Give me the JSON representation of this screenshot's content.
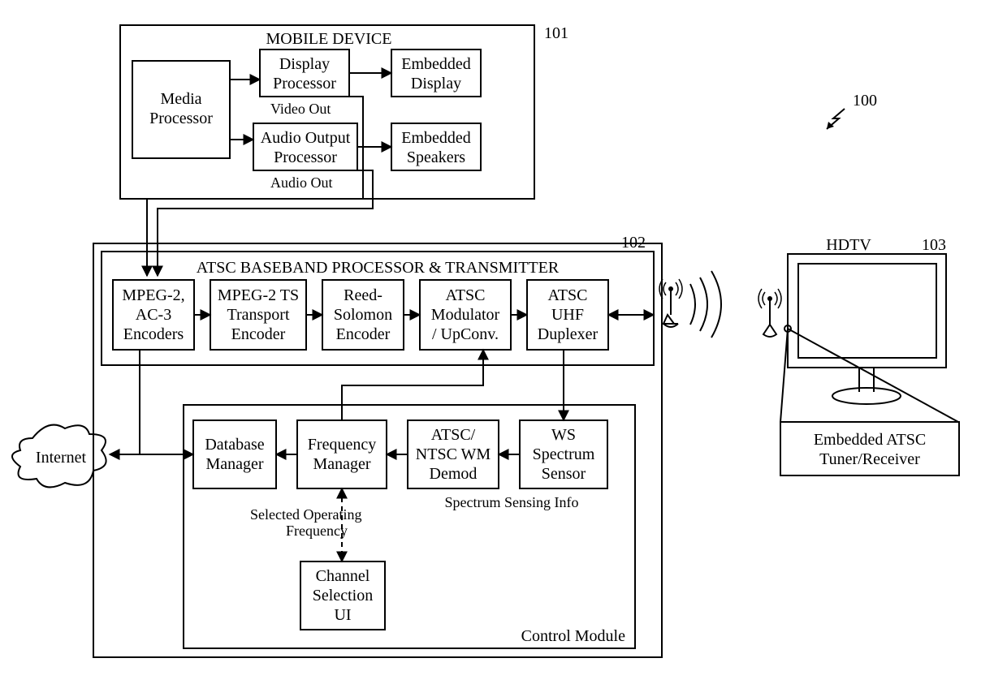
{
  "ref100": "100",
  "ref101": "101",
  "ref102": "102",
  "ref103": "103",
  "mobile_device": "MOBILE DEVICE",
  "media_processor_l1": "Media",
  "media_processor_l2": "Processor",
  "display_processor_l1": "Display",
  "display_processor_l2": "Processor",
  "embedded_display_l1": "Embedded",
  "embedded_display_l2": "Display",
  "audio_out_proc_l1": "Audio Output",
  "audio_out_proc_l2": "Processor",
  "embedded_speakers_l1": "Embedded",
  "embedded_speakers_l2": "Speakers",
  "video_out": "Video Out",
  "audio_out": "Audio Out",
  "atsc_header": "ATSC BASEBAND PROCESSOR & TRANSMITTER",
  "mpeg2_ac3_l1": "MPEG-2,",
  "mpeg2_ac3_l2": "AC-3",
  "mpeg2_ac3_l3": "Encoders",
  "mpeg2_ts_l1": "MPEG-2 TS",
  "mpeg2_ts_l2": "Transport",
  "mpeg2_ts_l3": "Encoder",
  "rs_l1": "Reed-",
  "rs_l2": "Solomon",
  "rs_l3": "Encoder",
  "mod_l1": "ATSC",
  "mod_l2": "Modulator",
  "mod_l3": "/ UpConv.",
  "dup_l1": "ATSC",
  "dup_l2": "UHF",
  "dup_l3": "Duplexer",
  "db_mgr_l1": "Database",
  "db_mgr_l2": "Manager",
  "freq_mgr_l1": "Frequency",
  "freq_mgr_l2": "Manager",
  "demod_l1": "ATSC/",
  "demod_l2": "NTSC WM",
  "demod_l3": "Demod",
  "ws_l1": "WS",
  "ws_l2": "Spectrum",
  "ws_l3": "Sensor",
  "channel_ui_l1": "Channel",
  "channel_ui_l2": "Selection",
  "channel_ui_l3": "UI",
  "sel_op_freq_l1": "Selected Operating",
  "sel_op_freq_l2": "Frequency",
  "spectrum_sensing_info": "Spectrum Sensing Info",
  "control_module": "Control Module",
  "internet": "Internet",
  "hdtv": "HDTV",
  "embedded_atsc_l1": "Embedded ATSC",
  "embedded_atsc_l2": "Tuner/Receiver"
}
